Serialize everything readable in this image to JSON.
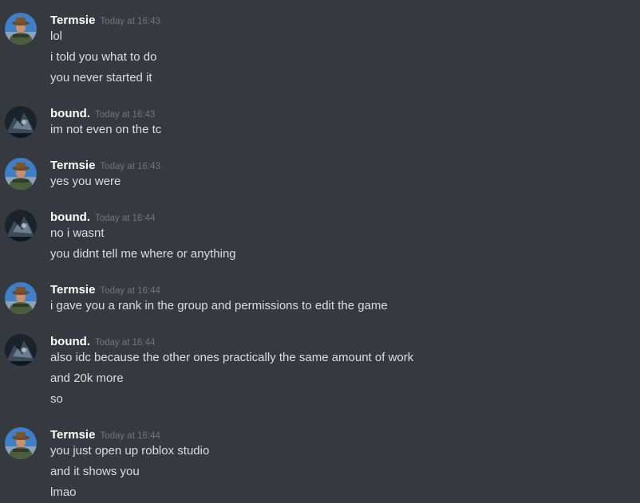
{
  "users": {
    "termsie": {
      "name": "Termsie",
      "avatar_icon": "cowboy-avatar-icon"
    },
    "bound": {
      "name": "bound.",
      "avatar_icon": "dark-art-avatar-icon"
    }
  },
  "messages": [
    {
      "author": "Termsie",
      "time": "Today at 16:43",
      "lines": [
        "lol",
        "i told you what to do",
        "you never started it"
      ]
    },
    {
      "author": "bound.",
      "time": "Today at 16:43",
      "lines": [
        "im not even on the tc"
      ]
    },
    {
      "author": "Termsie",
      "time": "Today at 16:43",
      "lines": [
        "yes you were"
      ]
    },
    {
      "author": "bound.",
      "time": "Today at 16:44",
      "lines": [
        "no i wasnt",
        "you didnt tell me where or anything"
      ]
    },
    {
      "author": "Termsie",
      "time": "Today at 16:44",
      "lines": [
        "i gave you a rank in the group and permissions to edit the game"
      ]
    },
    {
      "author": "bound.",
      "time": "Today at 16:44",
      "lines": [
        "also idc because the other ones practically the same amount of work",
        "and 20k more",
        "so"
      ]
    },
    {
      "author": "Termsie",
      "time": "Today at 16:44",
      "lines": [
        "you just open up roblox studio",
        "and it shows you",
        "lmao"
      ]
    }
  ],
  "colors": {
    "background": "#36393f",
    "username": "#ffffff",
    "timestamp": "#72767d",
    "message_text": "#dcddde"
  }
}
